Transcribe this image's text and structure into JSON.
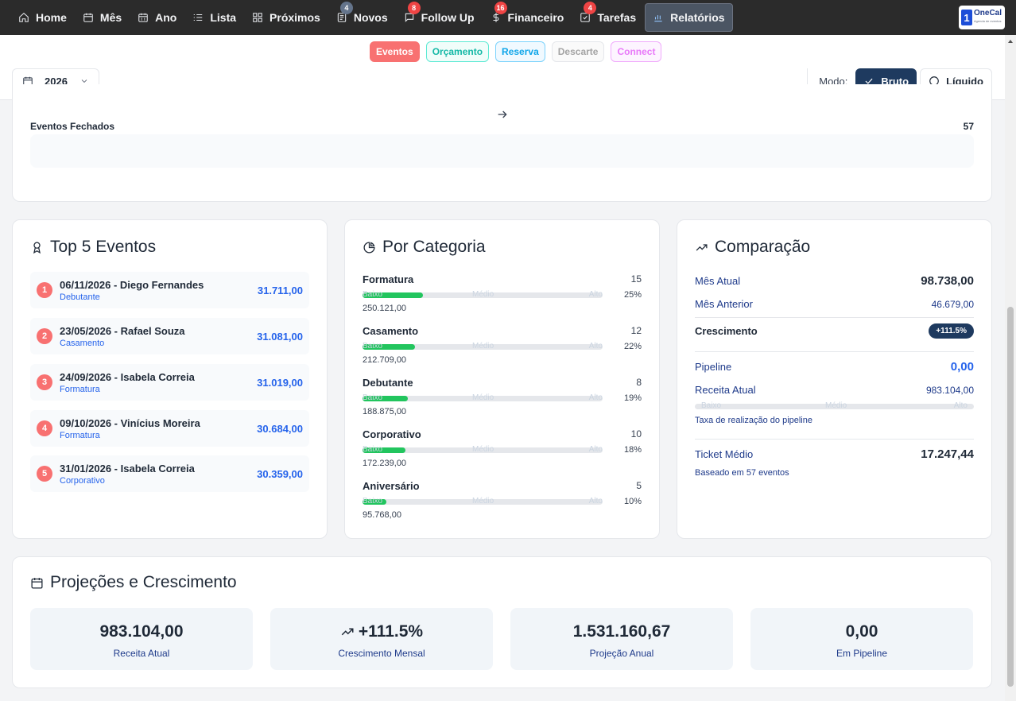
{
  "nav": {
    "items": [
      {
        "label": "Home",
        "icon": "home-icon"
      },
      {
        "label": "Mês",
        "icon": "calendar-icon"
      },
      {
        "label": "Ano",
        "icon": "calendar-grid-icon"
      },
      {
        "label": "Lista",
        "icon": "list-icon"
      },
      {
        "label": "Próximos",
        "icon": "grid-icon"
      },
      {
        "label": "Novos",
        "icon": "notes-icon",
        "badge": "4"
      },
      {
        "label": "Follow Up",
        "icon": "message-icon",
        "badge": "8"
      },
      {
        "label": "Financeiro",
        "icon": "dollar-icon",
        "badge": "16"
      },
      {
        "label": "Tarefas",
        "icon": "checkbox-icon",
        "badge": "4"
      },
      {
        "label": "Relatórios",
        "icon": "bar-chart-icon"
      }
    ],
    "logo_num": "1",
    "logo_text": "OneCal",
    "logo_sub": "Agenda de eventos"
  },
  "filters": {
    "chips": [
      "Eventos",
      "Orçamento",
      "Reserva",
      "Descarte",
      "Connect"
    ],
    "year": "2026",
    "mode_label": "Modo:",
    "mode_bruto": "Bruto",
    "mode_liquido": "Líquido"
  },
  "fechados": {
    "label": "Eventos Fechados",
    "value": "57"
  },
  "top5": {
    "title": "Top 5 Eventos",
    "items": [
      {
        "rank": "1",
        "name": "06/11/2026 - Diego Fernandes",
        "category": "Debutante",
        "value": "31.711,00"
      },
      {
        "rank": "2",
        "name": "23/05/2026 - Rafael Souza",
        "category": "Casamento",
        "value": "31.081,00"
      },
      {
        "rank": "3",
        "name": "24/09/2026 - Isabela Correia",
        "category": "Formatura",
        "value": "31.019,00"
      },
      {
        "rank": "4",
        "name": "09/10/2026 - Vinícius Moreira",
        "category": "Formatura",
        "value": "30.684,00"
      },
      {
        "rank": "5",
        "name": "31/01/2026 - Isabela Correia",
        "category": "Corporativo",
        "value": "30.359,00"
      }
    ]
  },
  "categoria": {
    "title": "Por Categoria",
    "bar_labels": [
      "Baixo",
      "Médio",
      "Alto"
    ],
    "items": [
      {
        "name": "Formatura",
        "count": "15",
        "pct": "25%",
        "fill": 0.25,
        "value": "250.121,00"
      },
      {
        "name": "Casamento",
        "count": "12",
        "pct": "22%",
        "fill": 0.22,
        "value": "212.709,00"
      },
      {
        "name": "Debutante",
        "count": "8",
        "pct": "19%",
        "fill": 0.19,
        "value": "188.875,00"
      },
      {
        "name": "Corporativo",
        "count": "10",
        "pct": "18%",
        "fill": 0.18,
        "value": "172.239,00"
      },
      {
        "name": "Aniversário",
        "count": "5",
        "pct": "10%",
        "fill": 0.1,
        "value": "95.768,00"
      }
    ]
  },
  "comparacao": {
    "title": "Comparação",
    "mes_atual_label": "Mês Atual",
    "mes_atual": "98.738,00",
    "mes_anterior_label": "Mês Anterior",
    "mes_anterior": "46.679,00",
    "crescimento_label": "Crescimento",
    "crescimento": "+111.5%",
    "pipeline_label": "Pipeline",
    "pipeline": "0,00",
    "receita_label": "Receita Atual",
    "receita": "983.104,00",
    "bar_labels": [
      "Baixo",
      "Médio",
      "Alto"
    ],
    "taxa_label": "Taxa de realização do pipeline",
    "ticket_label": "Ticket Médio",
    "ticket": "17.247,44",
    "ticket_note": "Baseado em 57 eventos"
  },
  "projecoes": {
    "title": "Projeções e Crescimento",
    "boxes": [
      {
        "value": "983.104,00",
        "label": "Receita Atual"
      },
      {
        "value": "+111.5%",
        "label": "Crescimento Mensal"
      },
      {
        "value": "1.531.160,67",
        "label": "Projeção Anual"
      },
      {
        "value": "0,00",
        "label": "Em Pipeline"
      }
    ]
  },
  "colors": {
    "nav_bg": "#2b2b2b",
    "accent_navy": "#1e3a5f",
    "link_blue": "#2563eb",
    "rank_red": "#f87171",
    "bar_green": "#22c55e"
  }
}
